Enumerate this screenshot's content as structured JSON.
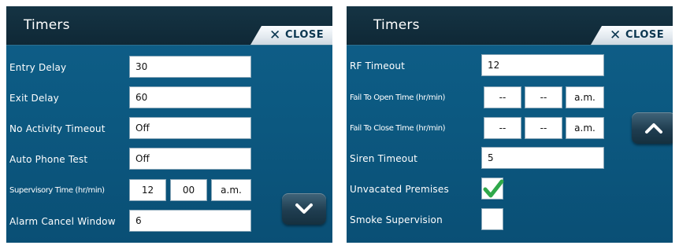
{
  "left_panel": {
    "title": "Timers",
    "close_label": "CLOSE",
    "rows": {
      "entry_delay": {
        "label": "Entry Delay",
        "value": "30"
      },
      "exit_delay": {
        "label": "Exit Delay",
        "value": "60"
      },
      "no_activity_timeout": {
        "label": "No Activity Timeout",
        "value": "Off"
      },
      "auto_phone_test": {
        "label": "Auto Phone Test",
        "value": "Off"
      },
      "supervisory_time": {
        "label": "Supervisory Time (hr/min)",
        "hour": "12",
        "minute": "00",
        "ampm": "a.m."
      },
      "alarm_cancel_window": {
        "label": "Alarm Cancel Window",
        "value": "6"
      }
    },
    "scroll_button_icon": "chevron-down-icon"
  },
  "right_panel": {
    "title": "Timers",
    "close_label": "CLOSE",
    "rows": {
      "rf_timeout": {
        "label": "RF Timeout",
        "value": "12"
      },
      "fail_to_open_time": {
        "label": "Fail To Open Time (hr/min)",
        "hour": "--",
        "minute": "--",
        "ampm": "a.m."
      },
      "fail_to_close_time": {
        "label": "Fail To Close Time (hr/min)",
        "hour": "--",
        "minute": "--",
        "ampm": "a.m."
      },
      "siren_timeout": {
        "label": "Siren Timeout",
        "value": "5"
      },
      "unvacated_premises": {
        "label": "Unvacated Premises",
        "checked": true
      },
      "smoke_supervision": {
        "label": "Smoke Supervision",
        "checked": false
      }
    },
    "scroll_button_icon": "chevron-up-icon"
  },
  "colors": {
    "panel_blue": "#0c5981",
    "titlebar_dark": "#132f3e",
    "checkmark_green": "#2fa84a",
    "close_text": "#0b3650"
  }
}
